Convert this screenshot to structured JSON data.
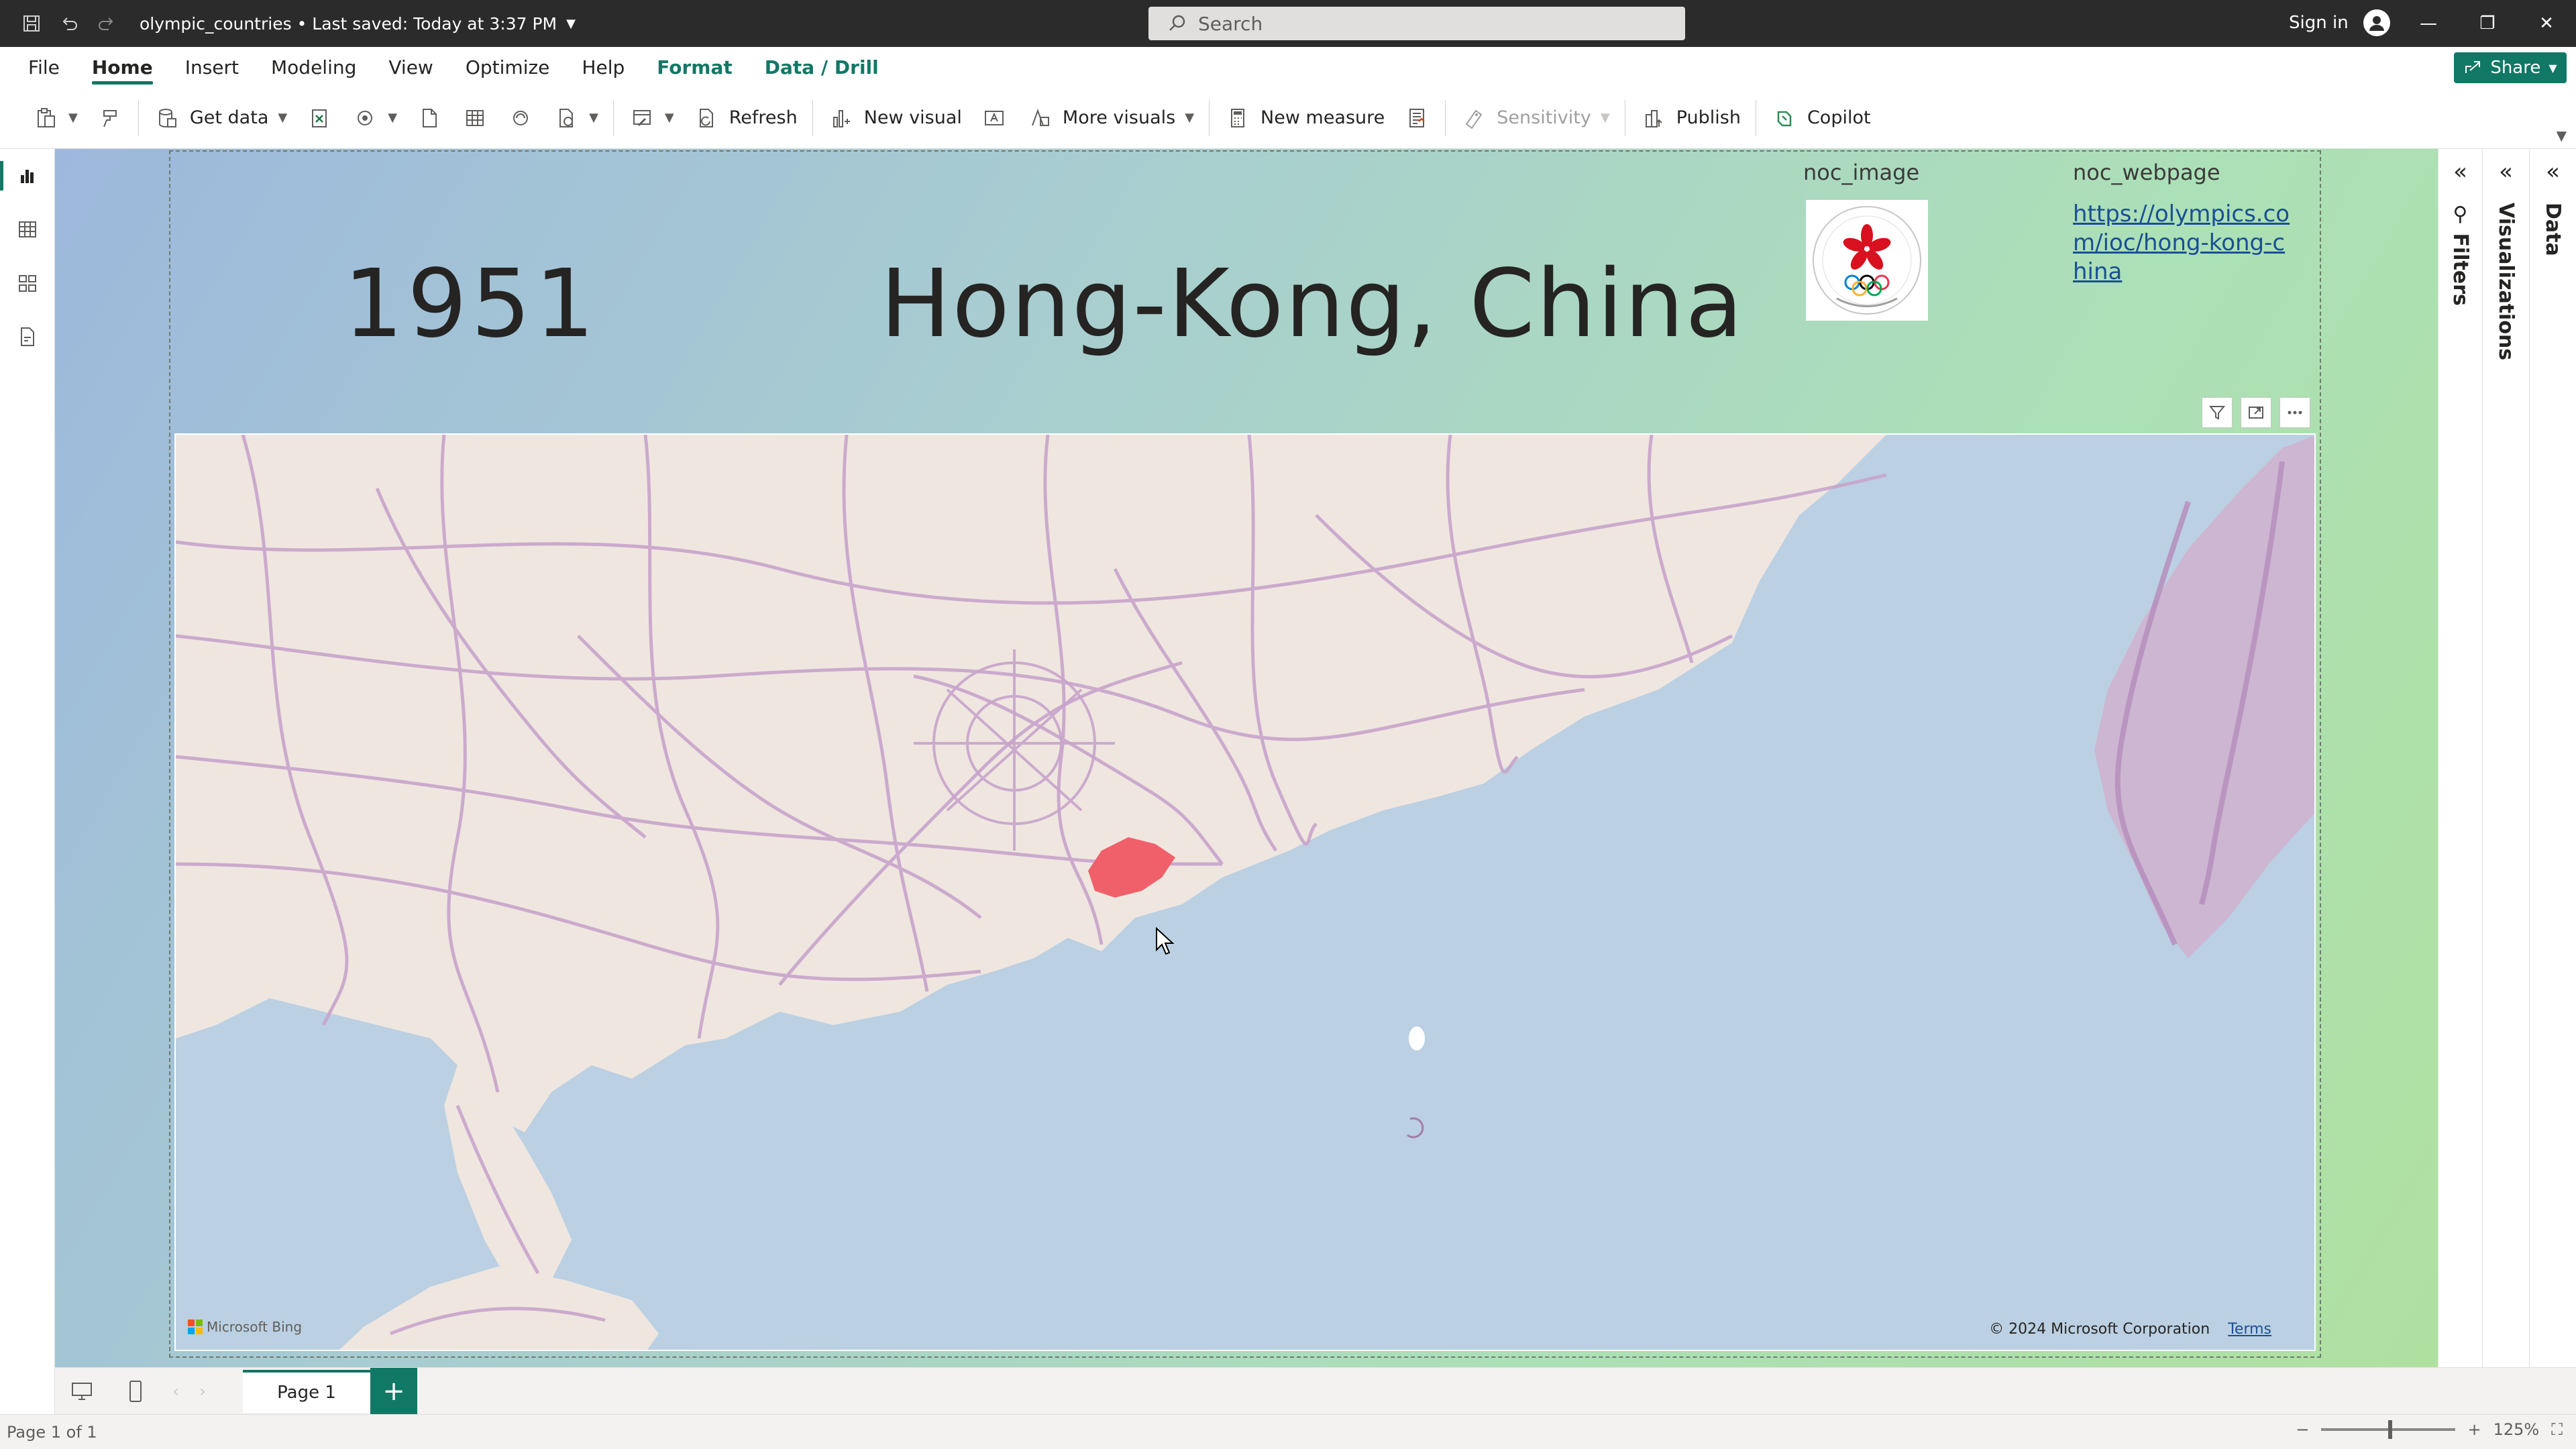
{
  "window": {
    "file_title": "olympic_countries",
    "saved_status": "Last saved: Today at 3:37 PM",
    "search_placeholder": "Search",
    "sign_in": "Sign in"
  },
  "menu": {
    "tabs": [
      "File",
      "Home",
      "Insert",
      "Modeling",
      "View",
      "Optimize",
      "Help",
      "Format",
      "Data / Drill"
    ],
    "active": "Home",
    "share_label": "Share"
  },
  "ribbon": {
    "get_data": "Get data",
    "refresh": "Refresh",
    "new_visual": "New visual",
    "more_visuals": "More visuals",
    "new_measure": "New measure",
    "sensitivity": "Sensitivity",
    "publish": "Publish",
    "copilot": "Copilot"
  },
  "report": {
    "year": "1951",
    "country": "Hong-Kong, China",
    "noc_image_label": "noc_image",
    "noc_webpage_label": "noc_webpage",
    "noc_webpage_url": "https://olympics.com/ioc/hong-kong-china",
    "map_provider": "Microsoft Bing",
    "map_copyright": "© 2024 Microsoft Corporation",
    "map_terms": "Terms",
    "highlight_color": "#f0606a"
  },
  "panes": {
    "filters": "Filters",
    "visualizations": "Visualizations",
    "data": "Data"
  },
  "pages": {
    "tabs": [
      "Page 1"
    ],
    "status": "Page 1 of 1",
    "zoom": "125%"
  }
}
